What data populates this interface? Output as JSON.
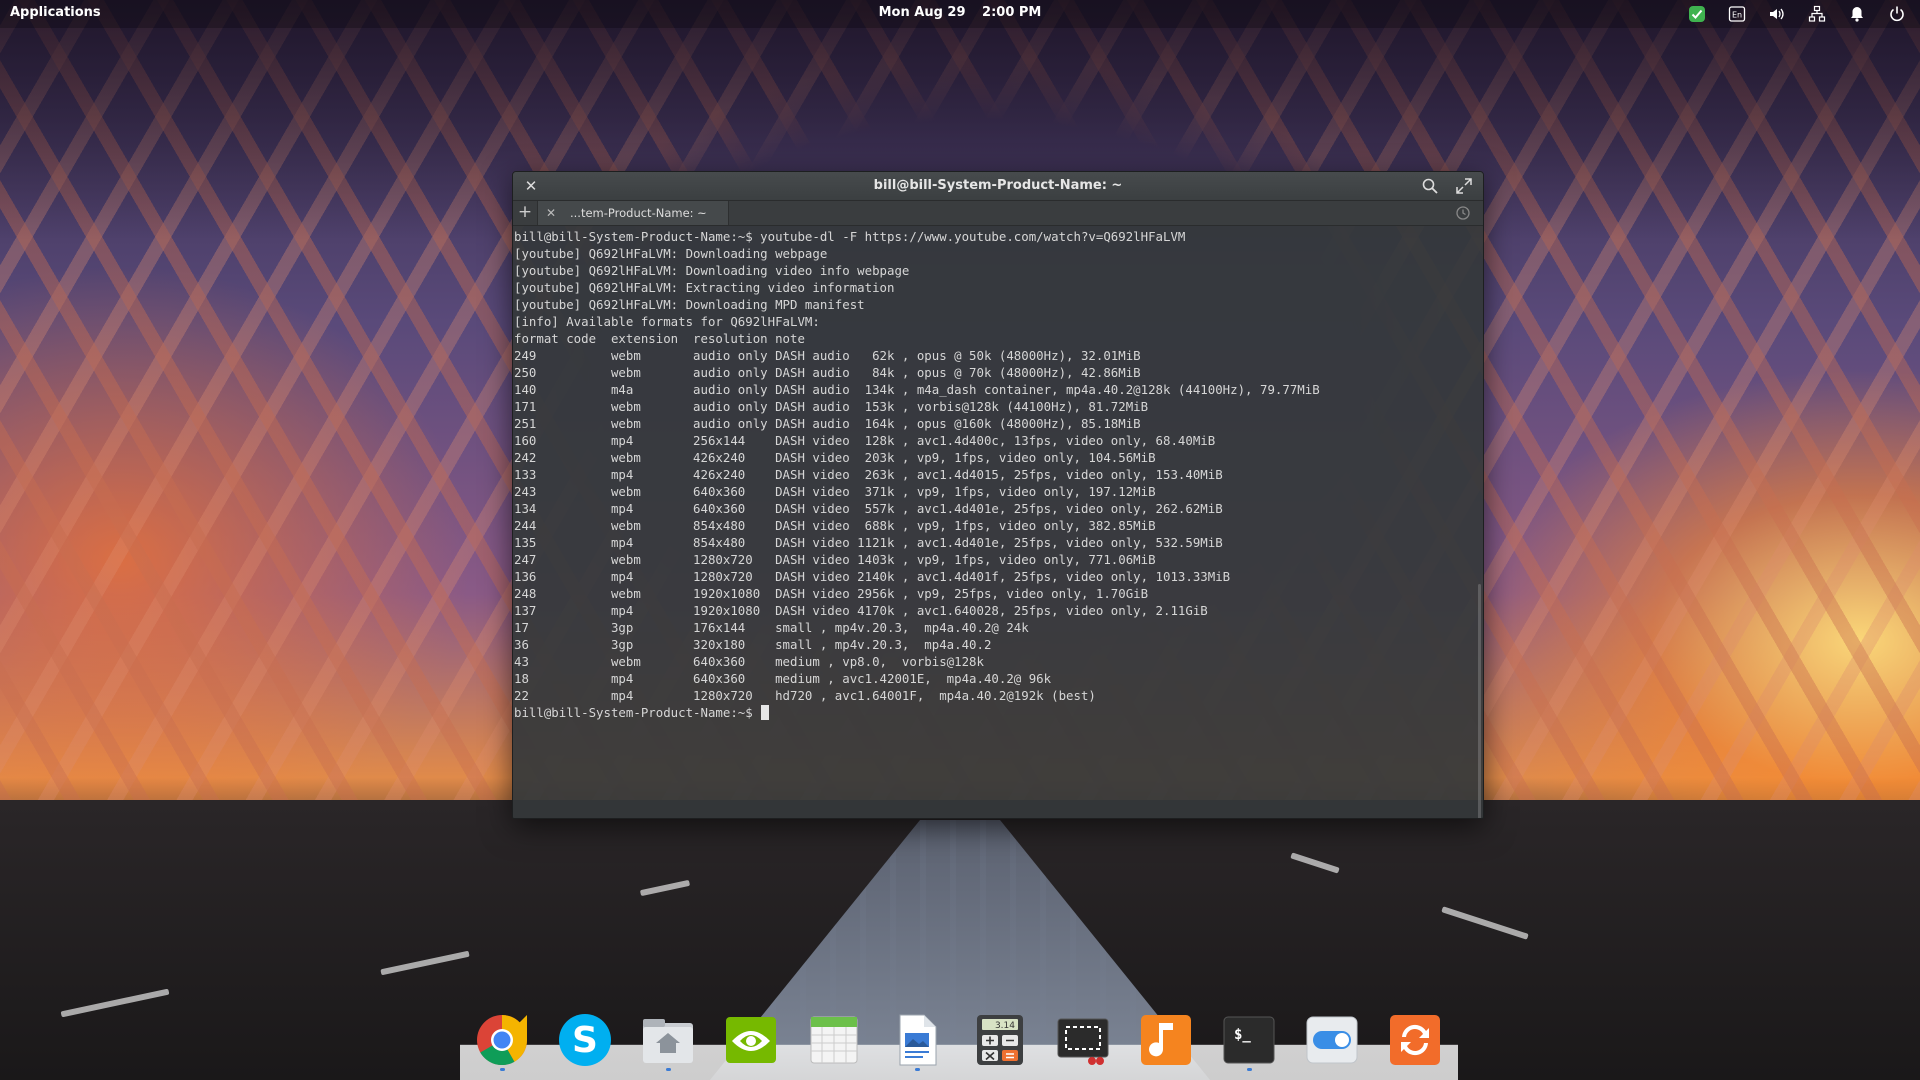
{
  "top_panel": {
    "applications_label": "Applications",
    "date": "Mon Aug 29",
    "time": "2:00 PM",
    "keyboard_layout": "En",
    "indicators": [
      "checkmark-shield-icon",
      "keyboard-layout-icon",
      "volume-icon",
      "network-icon",
      "notifications-bell-icon",
      "power-icon"
    ]
  },
  "terminal": {
    "title": "bill@bill-System-Product-Name: ~",
    "tab_label": "...tem-Product-Name: ~",
    "lines": [
      "bill@bill-System-Product-Name:~$ youtube-dl -F https://www.youtube.com/watch?v=Q692lHFaLVM",
      "[youtube] Q692lHFaLVM: Downloading webpage",
      "[youtube] Q692lHFaLVM: Downloading video info webpage",
      "[youtube] Q692lHFaLVM: Extracting video information",
      "[youtube] Q692lHFaLVM: Downloading MPD manifest",
      "[info] Available formats for Q692lHFaLVM:",
      "format code  extension  resolution note",
      "249          webm       audio only DASH audio   62k , opus @ 50k (48000Hz), 32.01MiB",
      "250          webm       audio only DASH audio   84k , opus @ 70k (48000Hz), 42.86MiB",
      "140          m4a        audio only DASH audio  134k , m4a_dash container, mp4a.40.2@128k (44100Hz), 79.77MiB",
      "171          webm       audio only DASH audio  153k , vorbis@128k (44100Hz), 81.72MiB",
      "251          webm       audio only DASH audio  164k , opus @160k (48000Hz), 85.18MiB",
      "160          mp4        256x144    DASH video  128k , avc1.4d400c, 13fps, video only, 68.40MiB",
      "242          webm       426x240    DASH video  203k , vp9, 1fps, video only, 104.56MiB",
      "133          mp4        426x240    DASH video  263k , avc1.4d4015, 25fps, video only, 153.40MiB",
      "243          webm       640x360    DASH video  371k , vp9, 1fps, video only, 197.12MiB",
      "134          mp4        640x360    DASH video  557k , avc1.4d401e, 25fps, video only, 262.62MiB",
      "244          webm       854x480    DASH video  688k , vp9, 1fps, video only, 382.85MiB",
      "135          mp4        854x480    DASH video 1121k , avc1.4d401e, 25fps, video only, 532.59MiB",
      "247          webm       1280x720   DASH video 1403k , vp9, 1fps, video only, 771.06MiB",
      "136          mp4        1280x720   DASH video 2140k , avc1.4d401f, 25fps, video only, 1013.33MiB",
      "248          webm       1920x1080  DASH video 2956k , vp9, 25fps, video only, 1.70GiB",
      "137          mp4        1920x1080  DASH video 4170k , avc1.640028, 25fps, video only, 2.11GiB",
      "17           3gp        176x144    small , mp4v.20.3,  mp4a.40.2@ 24k",
      "36           3gp        320x180    small , mp4v.20.3,  mp4a.40.2",
      "43           webm       640x360    medium , vp8.0,  vorbis@128k",
      "18           mp4        640x360    medium , avc1.42001E,  mp4a.40.2@ 96k",
      "22           mp4        1280x720   hd720 , avc1.64001F,  mp4a.40.2@192k (best)"
    ],
    "prompt": "bill@bill-System-Product-Name:~$ "
  },
  "dock": {
    "items": [
      {
        "name": "chrome-icon",
        "running": true
      },
      {
        "name": "skype-icon",
        "running": false
      },
      {
        "name": "files-home-icon",
        "running": true
      },
      {
        "name": "nvidia-settings-icon",
        "running": false
      },
      {
        "name": "calendar-icon",
        "running": false
      },
      {
        "name": "document-viewer-icon",
        "running": true
      },
      {
        "name": "calculator-icon",
        "running": false,
        "display": "3.14"
      },
      {
        "name": "screenshot-icon",
        "running": false
      },
      {
        "name": "music-icon",
        "running": false
      },
      {
        "name": "terminal-icon",
        "running": true,
        "glyph": "$_"
      },
      {
        "name": "system-settings-icon",
        "running": false
      },
      {
        "name": "software-update-icon",
        "running": false
      }
    ]
  }
}
